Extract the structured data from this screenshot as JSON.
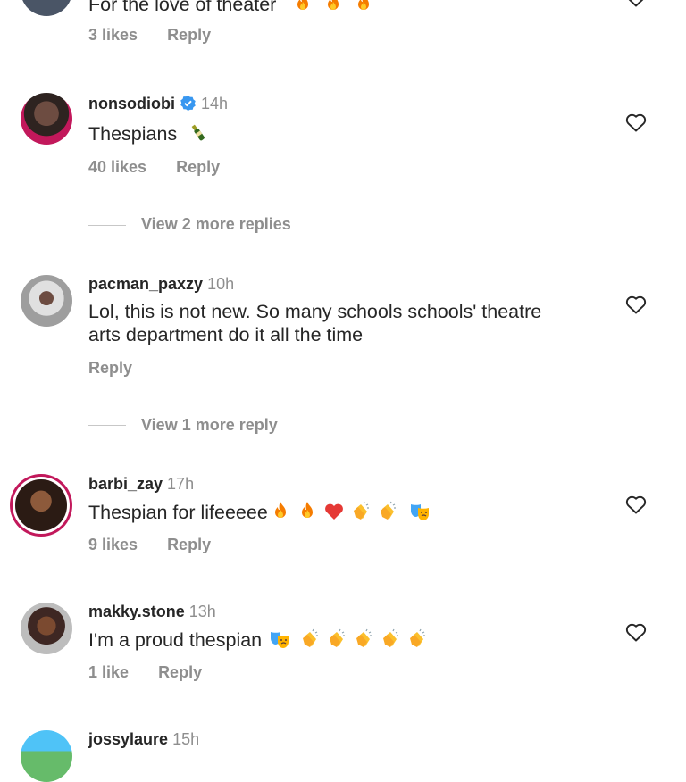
{
  "comments": [
    {
      "username": "",
      "time": "",
      "text": "For the love of theater",
      "emojis": [
        "fire",
        "fire",
        "fire"
      ],
      "likes": "3 likes",
      "reply": "Reply"
    },
    {
      "username": "nonsodiobi",
      "verified": true,
      "time": "14h",
      "text": "Thespians",
      "emojis": [
        "champagne"
      ],
      "likes": "40 likes",
      "reply": "Reply",
      "view_more": "View 2 more replies"
    },
    {
      "username": "pacman_paxzy",
      "time": "10h",
      "text_line1": "Lol, this is not new. So many schools schools' theatre",
      "text_line2": "arts department do it all the time",
      "reply": "Reply",
      "view_more": "View 1 more reply"
    },
    {
      "username": "barbi_zay",
      "time": "17h",
      "text": "Thespian for lifeeeee",
      "emojis": [
        "fire",
        "fire",
        "red-heart",
        "clapping-hands",
        "clapping-hands",
        "performing-arts"
      ],
      "likes": "9 likes",
      "reply": "Reply"
    },
    {
      "username": "makky.stone",
      "time": "13h",
      "text": "I'm a proud thespian",
      "emojis": [
        "performing-arts",
        "clapping-hands",
        "clapping-hands",
        "clapping-hands",
        "clapping-hands",
        "clapping-hands"
      ],
      "likes": "1 like",
      "reply": "Reply"
    },
    {
      "username": "jossylaure",
      "time": "15h"
    }
  ],
  "colors": {
    "text": "#262626",
    "secondary": "#8e8e8e",
    "verified": "#3897f0",
    "story_ring": "#c2185b"
  }
}
